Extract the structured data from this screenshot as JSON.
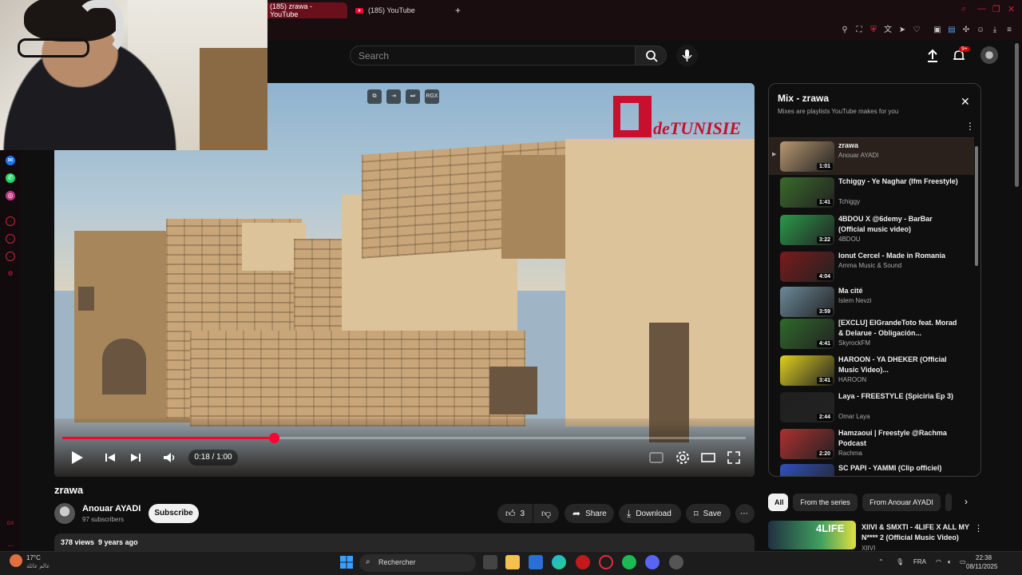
{
  "browser": {
    "tabs": [
      {
        "label": "(185) zrawa - YouTube",
        "active": true
      },
      {
        "label": "(185) YouTube",
        "active": false
      }
    ],
    "new_tab": "+",
    "accent": "#c7243b"
  },
  "header": {
    "search_placeholder": "Search",
    "notifications_badge": "9+"
  },
  "player": {
    "progress": 0.31,
    "time": "0:18 / 1:00",
    "extension_btn": "RGX",
    "watermark_text": "deTUNISIE"
  },
  "video": {
    "title": "zrawa",
    "channel": "Anouar AYADI",
    "subscribers": "97 subscribers",
    "subscribe_label": "Subscribe",
    "likes": "3",
    "share_label": "Share",
    "download_label": "Download",
    "save_label": "Save",
    "stats": "378 views  9 years ago"
  },
  "mix": {
    "title": "Mix - zrawa",
    "subtitle": "Mixes are playlists YouTube makes for you",
    "items": [
      {
        "title": "zrawa",
        "channel": "Anouar AYADI",
        "duration": "1:01",
        "current": true
      },
      {
        "title": "Tchiggy - Ye Naghar (Ifm Freestyle)",
        "channel": "Tchiggy",
        "duration": "1:41"
      },
      {
        "title": "4BDOU X @6demy - BarBar (Official music video)",
        "channel": "4BDOU",
        "duration": "3:22"
      },
      {
        "title": "Ionut Cercel - Made in Romania",
        "channel": "Amma Music & Sound",
        "duration": "4:04"
      },
      {
        "title": "Ma cité",
        "channel": "Islem Nevzi",
        "duration": "3:59"
      },
      {
        "title": "[EXCLU] ElGrandeToto feat. Morad & Delarue - Obligación...",
        "channel": "SkyrockFM",
        "duration": "4:41"
      },
      {
        "title": "HAROON - YA DHEKER (Official Music Video)...",
        "channel": "HAROON",
        "duration": "3:41"
      },
      {
        "title": "Laya - FREESTYLE (Spiciria Ep 3)",
        "channel": "Omar Laya",
        "duration": "2:44"
      },
      {
        "title": "Hamzaoui | Freestyle @Rachma Podcast",
        "channel": "Rachma",
        "duration": "2:20"
      },
      {
        "title": "SC PAPI - YAMMI (Clip officiel)",
        "channel": "",
        "duration": ""
      }
    ]
  },
  "chips": [
    "All",
    "From the series",
    "From Anouar AYADI"
  ],
  "recommended": {
    "title": "XIIVI & SMXTI - 4LIFE X ALL MY N**** 2 (Official Music Video)",
    "channel": "XIIVI",
    "thumb_text": "4LIFE"
  },
  "taskbar": {
    "weather_temp": "17°C",
    "weather_desc": "عالم عائلة",
    "search_label": "Rechercher",
    "lang": "FRA",
    "time": "22:38",
    "date": "08/11/2025"
  }
}
